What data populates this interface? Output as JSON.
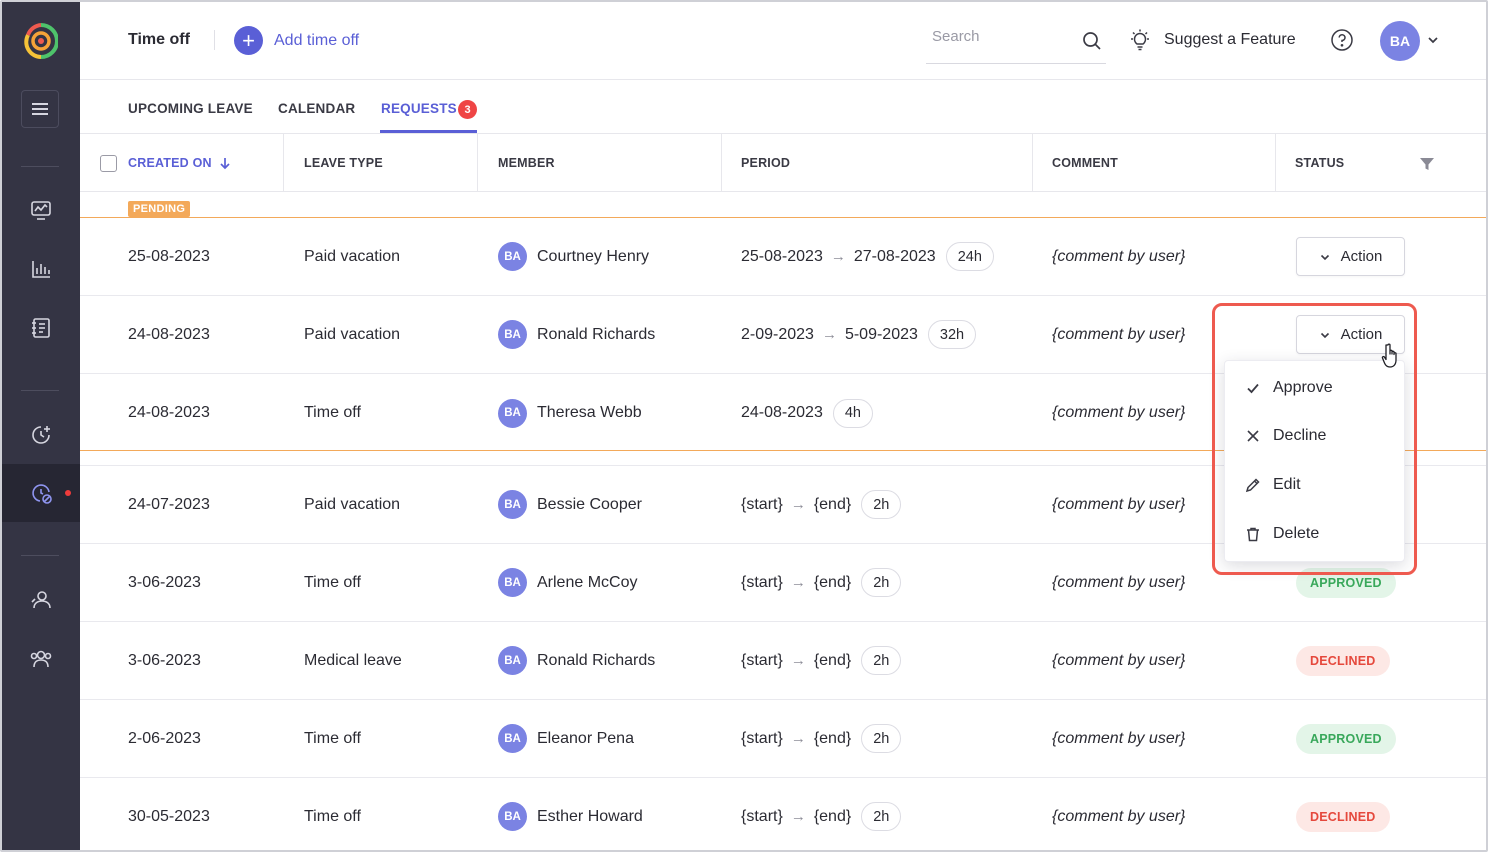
{
  "header": {
    "title": "Time off",
    "add_label": "Add time off",
    "search_placeholder": "Search",
    "suggest_label": "Suggest a Feature",
    "avatar_initials": "BA"
  },
  "tabs": [
    {
      "label": "UPCOMING LEAVE",
      "active": false
    },
    {
      "label": "CALENDAR",
      "active": false
    },
    {
      "label": "REQUESTS",
      "active": true,
      "badge": "3"
    }
  ],
  "columns": {
    "created_on": "CREATED ON",
    "leave_type": "LEAVE TYPE",
    "member": "MEMBER",
    "period": "PERIOD",
    "comment": "COMMENT",
    "status": "STATUS"
  },
  "pending_label": "PENDING",
  "rows": [
    {
      "created": "25-08-2023",
      "type": "Paid vacation",
      "initials": "BA",
      "member": "Courtney Henry",
      "start": "25-08-2023",
      "end": "27-08-2023",
      "hours": "24h",
      "comment": "{comment by user}",
      "action": "Action"
    },
    {
      "created": "24-08-2023",
      "type": "Paid vacation",
      "initials": "BA",
      "member": "Ronald Richards",
      "start": "2-09-2023",
      "end": "5-09-2023",
      "hours": "32h",
      "comment": "{comment by user}",
      "action": "Action"
    },
    {
      "created": "24-08-2023",
      "type": "Time off",
      "initials": "BA",
      "member": "Theresa Webb",
      "start": "24-08-2023",
      "end": "",
      "hours": "4h",
      "comment": "{comment by user}"
    },
    {
      "created": "24-07-2023",
      "type": "Paid vacation",
      "initials": "BA",
      "member": "Bessie Cooper",
      "start": "{start}",
      "end": "{end}",
      "hours": "2h",
      "comment": "{comment by user}"
    },
    {
      "created": "3-06-2023",
      "type": "Time off",
      "initials": "BA",
      "member": "Arlene McCoy",
      "start": "{start}",
      "end": "{end}",
      "hours": "2h",
      "comment": "{comment by user}",
      "status": "APPROVED"
    },
    {
      "created": "3-06-2023",
      "type": "Medical leave",
      "initials": "BA",
      "member": "Ronald Richards",
      "start": "{start}",
      "end": "{end}",
      "hours": "2h",
      "comment": "{comment by user}",
      "status": "DECLINED"
    },
    {
      "created": "2-06-2023",
      "type": "Time off",
      "initials": "BA",
      "member": "Eleanor Pena",
      "start": "{start}",
      "end": "{end}",
      "hours": "2h",
      "comment": "{comment by user}",
      "status": "APPROVED"
    },
    {
      "created": "30-05-2023",
      "type": "Time off",
      "initials": "BA",
      "member": "Esther Howard",
      "start": "{start}",
      "end": "{end}",
      "hours": "2h",
      "comment": "{comment by user}",
      "status": "DECLINED"
    }
  ],
  "dropdown": {
    "approve": "Approve",
    "decline": "Decline",
    "edit": "Edit",
    "delete": "Delete"
  },
  "colors": {
    "sidebar": "#343444",
    "accent": "#5a5fd6",
    "pending": "#f3a95a",
    "approved": "#39a85b",
    "declined": "#e5483c",
    "highlight": "#ee5a4f"
  },
  "sidebar_icons": [
    "menu-icon",
    "dashboard-icon",
    "reports-icon",
    "timesheet-icon",
    "time-tracking-icon",
    "time-off-icon",
    "member-icon",
    "team-icon"
  ]
}
